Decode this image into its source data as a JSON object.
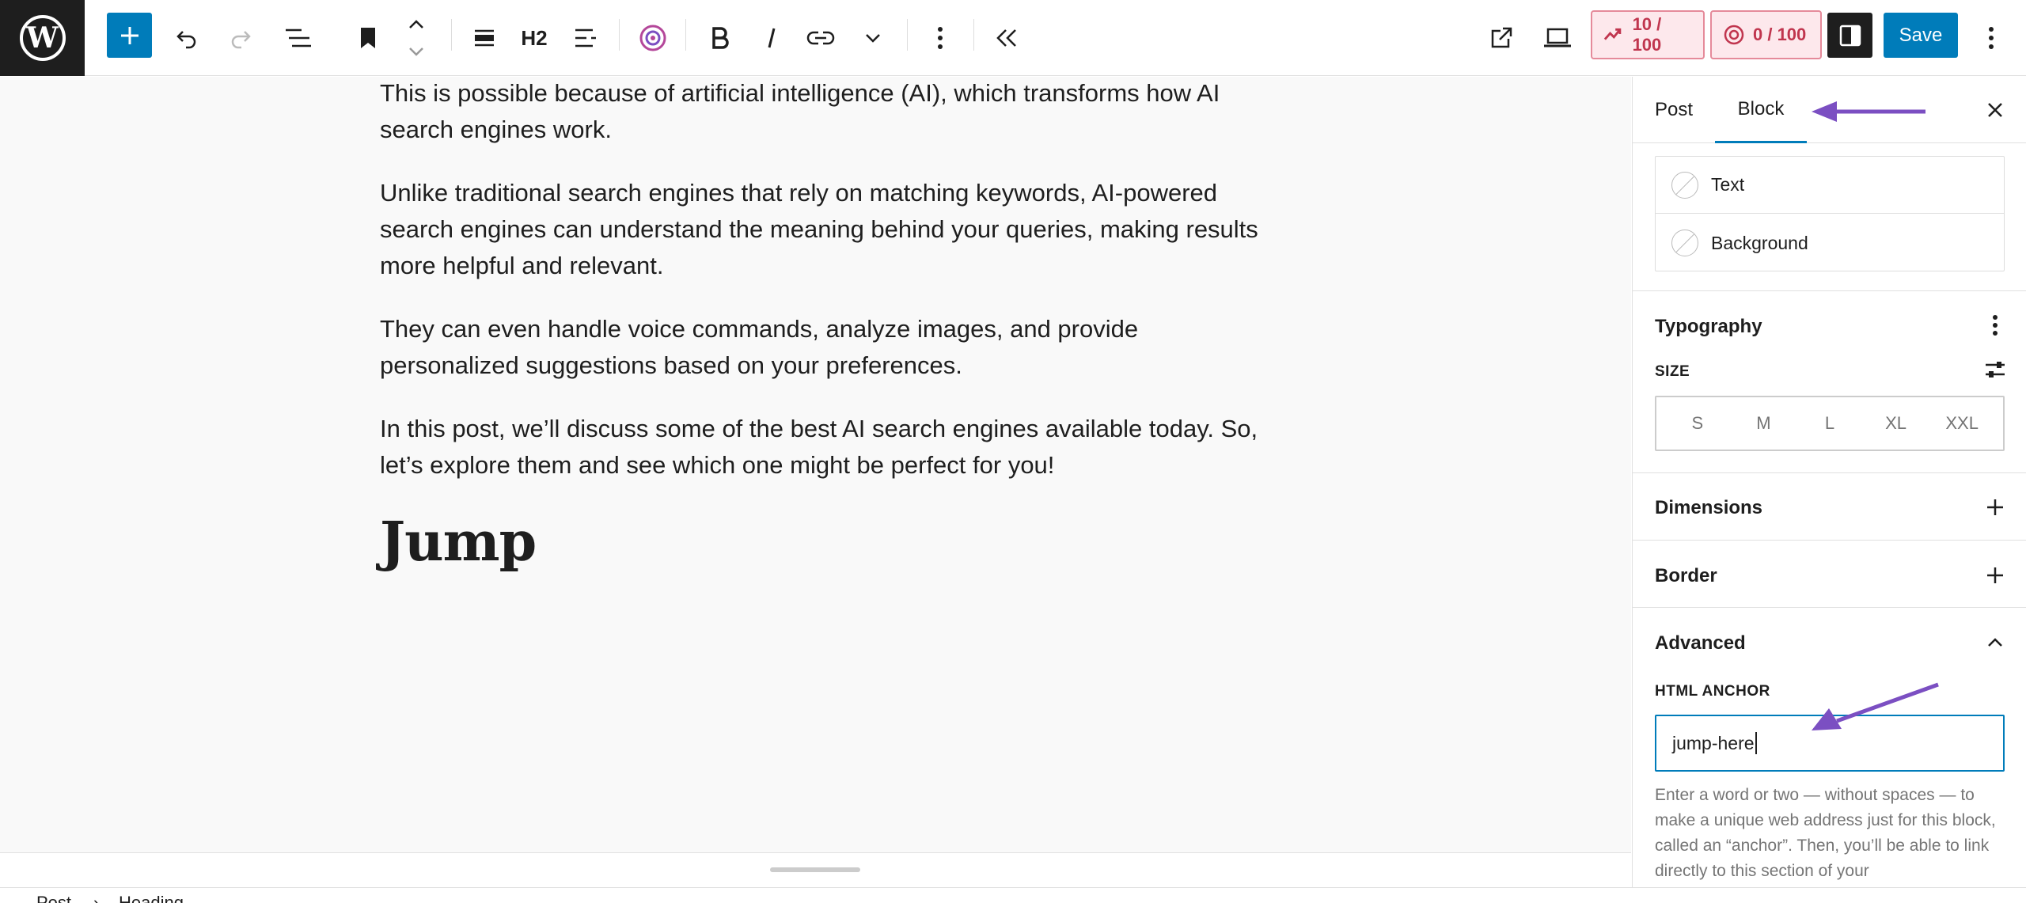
{
  "toolbar": {
    "block_type": "H2",
    "seo_score": "10 / 100",
    "ai_score": "0 / 100",
    "save_label": "Save",
    "icons": [
      "wordpress-logo",
      "plus",
      "undo",
      "redo",
      "list-view",
      "bookmark",
      "move-up-down",
      "align",
      "text-align",
      "plugin-logo",
      "bold",
      "italic",
      "link",
      "chevron-down",
      "more-vertical",
      "collapse"
    ]
  },
  "content": {
    "paragraphs": [
      "This is possible because of artificial intelligence (AI), which transforms how AI search engines work.",
      "Unlike traditional search engines that rely on matching keywords, AI-powered search engines can understand the meaning behind your queries, making results more helpful and relevant.",
      "They can even handle voice commands, analyze images, and provide personalized suggestions based on your preferences.",
      "In this post, we’ll discuss some of the best AI search engines available today. So, let’s explore them and see which one might be perfect for you!"
    ],
    "heading": "Jump"
  },
  "breadcrumb": {
    "items": [
      "Post",
      "Heading"
    ]
  },
  "sidebar": {
    "tabs": [
      "Post",
      "Block"
    ],
    "active_tab": "Block",
    "color": {
      "text_label": "Text",
      "background_label": "Background"
    },
    "typography": {
      "title": "Typography",
      "size_label": "SIZE",
      "sizes": [
        "S",
        "M",
        "L",
        "XL",
        "XXL"
      ]
    },
    "dimensions_title": "Dimensions",
    "border_title": "Border",
    "advanced": {
      "title": "Advanced",
      "anchor_label": "HTML ANCHOR",
      "anchor_value": "jump-here",
      "help_text": "Enter a word or two — without spaces — to make a unique web address just for this block, called an “anchor”. Then, you’ll be able to link directly to this section of your"
    }
  },
  "colors": {
    "accent": "#007cba",
    "annotation_arrow": "#7b4fc2",
    "score_bg": "#fde8ec",
    "score_text": "#c0354e"
  }
}
